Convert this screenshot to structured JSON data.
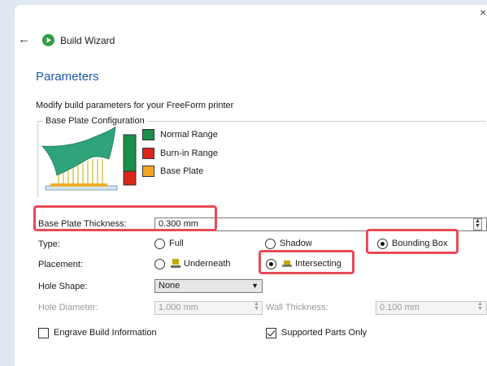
{
  "window": {
    "title": "Build Wizard",
    "close_glyph": "×",
    "back_glyph": "←"
  },
  "section": {
    "title": "Parameters",
    "subtitle": "Modify build parameters for your FreeForm printer"
  },
  "base_plate_config": {
    "label": "Base Plate Configuration",
    "legend": [
      {
        "label": "Normal Range",
        "color": "#1a8f4a"
      },
      {
        "label": "Burn-in Range",
        "color": "#d9261c"
      },
      {
        "label": "Base Plate",
        "color": "#f5a623"
      }
    ]
  },
  "form": {
    "thickness": {
      "label": "Base Plate Thickness:",
      "value": "0.300 mm"
    },
    "type": {
      "label": "Type:",
      "options": [
        {
          "label": "Full",
          "checked": false
        },
        {
          "label": "Shadow",
          "checked": false
        },
        {
          "label": "Bounding Box",
          "checked": true
        }
      ]
    },
    "placement": {
      "label": "Placement:",
      "options": [
        {
          "label": "Underneath",
          "checked": false
        },
        {
          "label": "Intersecting",
          "checked": true
        }
      ]
    },
    "hole_shape": {
      "label": "Hole Shape:",
      "value": "None"
    },
    "hole_diameter": {
      "label": "Hole Diameter:",
      "value": "1.000 mm"
    },
    "wall_thickness": {
      "label": "Wall Thickness:",
      "value": "0.100 mm"
    },
    "engrave": {
      "label": "Engrave Build Information",
      "checked": false
    },
    "supported_only": {
      "label": "Supported Parts Only",
      "checked": true
    }
  },
  "colors": {
    "accent": "#1a5aa8",
    "highlight": "#e84a57",
    "app_icon": "#2f9d3e"
  }
}
